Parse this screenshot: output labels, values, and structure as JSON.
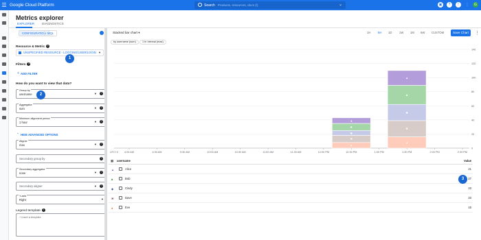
{
  "topbar": {
    "brand": "Google Cloud Platform",
    "search_label": "Search",
    "search_placeholder": "Products, resources, docs (/)"
  },
  "page": {
    "title": "Metrics explorer"
  },
  "tabs": [
    {
      "label": "EXPLORER"
    },
    {
      "label": "DIAGNOSTICS"
    }
  ],
  "panel": {
    "config_label": "CONFIGURATION",
    "mql_label": "MQL",
    "resource_title": "Resource & Metric",
    "resource_value": "UNSPECIFIED RESOURCE - LOGGING/USER/LOGIN",
    "filters_title": "Filters",
    "add_filter": "ADD FILTER",
    "view_title": "How do you want to view that data?",
    "group_by_label": "Group by",
    "group_by_value": "username",
    "aggregator_label": "Aggregator",
    "aggregator_value": "sum",
    "alignment_label": "Minimum alignment period",
    "alignment_value": "1 hour",
    "hide_advanced": "HIDE ADVANCED OPTIONS",
    "aligner_label": "Aligner",
    "aligner_value": "max",
    "secondary_group_ph": "Secondary group by",
    "secondary_agg_label": "Secondary aggregator",
    "secondary_agg_value": "none",
    "secondary_aligner_ph": "Secondary aligner",
    "yaxis_label": "Y-axis",
    "yaxis_value": "Right",
    "legend_title": "Legend template",
    "legend_ph": "+ Insert a template"
  },
  "callouts": [
    "1",
    "2",
    "3"
  ],
  "chart": {
    "type_label": "Stacked bar chart",
    "ranges": [
      "1H",
      "6H",
      "1D",
      "1W",
      "1M",
      "6W",
      "CUSTOM"
    ],
    "active_range": "6H",
    "save_label": "Save Chart",
    "chips": [
      "by username (sum)",
      "1 hr interval (max)"
    ],
    "timezone": "UTC+2"
  },
  "chart_data": {
    "type": "bar",
    "categories": [
      "12:30 PM",
      "1:30 PM"
    ],
    "series": [
      {
        "name": "Alice",
        "color": "#b39ddb",
        "values": [
          8,
          21
        ]
      },
      {
        "name": "Bob",
        "color": "#a5d6a7",
        "values": [
          10,
          27
        ]
      },
      {
        "name": "Cindy",
        "color": "#c5cae9",
        "values": [
          7,
          23
        ]
      },
      {
        "name": "Dave",
        "color": "#d7ccc8",
        "values": [
          10,
          23
        ]
      },
      {
        "name": "Eve",
        "color": "#ffccbc",
        "values": [
          8,
          16
        ]
      }
    ],
    "x_ticks": [
      "4:00 AM",
      "4:30 AM",
      "9:30 AM",
      "10:00 AM",
      "10:30 AM",
      "11:00 AM",
      "11:30 AM",
      "12:00 PM",
      "12:30 PM",
      "1:00 PM",
      "1:30 PM",
      "2:00 PM",
      "2:30 PM"
    ],
    "y_ticks": [
      "140",
      "120",
      "100",
      "80",
      "60",
      "40",
      "20",
      "0"
    ],
    "ylim": [
      0,
      140
    ]
  },
  "table": {
    "col_name": "username",
    "col_value": "Value",
    "rows": [
      {
        "marker": "▲",
        "color": "#7e57c2",
        "name": "Alice",
        "value": "21"
      },
      {
        "marker": "■",
        "color": "#43a047",
        "name": "Bob",
        "value": "27"
      },
      {
        "marker": "◆",
        "color": "#3949ab",
        "name": "Cindy",
        "value": "23"
      },
      {
        "marker": "✖",
        "color": "#6d4c41",
        "name": "Dave",
        "value": "23"
      },
      {
        "marker": "●",
        "color": "#f4511e",
        "name": "Eve",
        "value": "16"
      }
    ]
  }
}
